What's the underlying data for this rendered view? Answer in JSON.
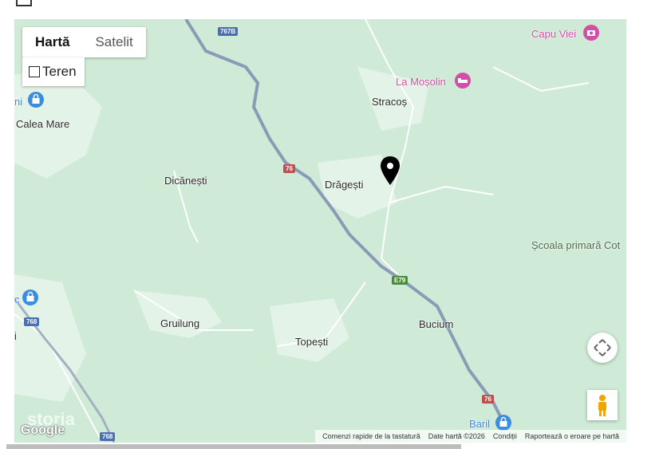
{
  "map_type": {
    "map": "Hartă",
    "satellite": "Satelit",
    "terrain": "Teren",
    "selected": "map"
  },
  "places": {
    "capu_viei": "Capu Viei",
    "la_mosolin": "La Moșolin",
    "stracos": "Stracoș",
    "calea_mare": "Calea Mare",
    "ni_partial": "ni",
    "dicanesti": "Dicănești",
    "dragesti": "Drăgești",
    "scoala": "Școala primară Cot",
    "c_partial": "c",
    "i_partial": "i",
    "gruilung": "Gruilung",
    "topesti": "Topești",
    "bucium": "Bucium",
    "baril": "Baril"
  },
  "roads": {
    "r767b": "767B",
    "r76a": "76",
    "r79": "E79",
    "r768a": "768",
    "r768b": "768",
    "r76b": "76"
  },
  "watermark": "storia",
  "logo": "Google",
  "footer": {
    "shortcuts": "Comenzi rapide de la tastatură",
    "data": "Date hartă ©2026",
    "terms": "Condiții",
    "report": "Raportează o eroare pe hartă"
  },
  "colors": {
    "land": "#cfead7",
    "road": "#8a9bb5",
    "poi_pink": "#d14fa6",
    "poi_blue": "#3b8de0"
  },
  "icons": [
    "map-pin-icon",
    "camera-icon",
    "hotel-icon",
    "shopping-bag-icon",
    "navigation-icon",
    "pegman-icon"
  ]
}
